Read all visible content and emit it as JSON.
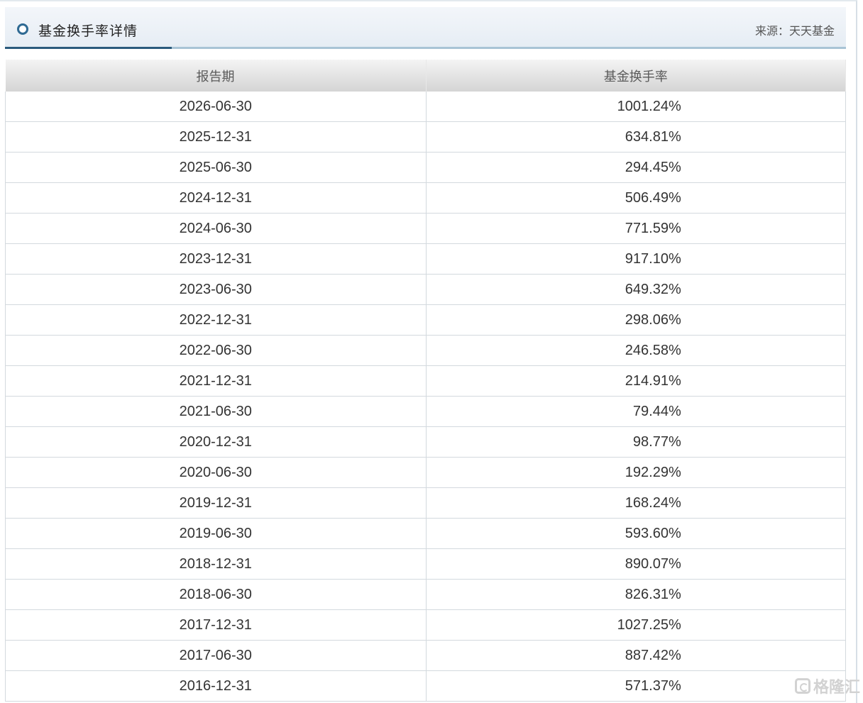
{
  "panel": {
    "title": "基金换手率详情",
    "source": "来源：天天基金"
  },
  "table": {
    "headers": [
      "报告期",
      "基金换手率"
    ],
    "rows": [
      {
        "period": "2026-06-30",
        "rate": "1001.24%"
      },
      {
        "period": "2025-12-31",
        "rate": "634.81%"
      },
      {
        "period": "2025-06-30",
        "rate": "294.45%"
      },
      {
        "period": "2024-12-31",
        "rate": "506.49%"
      },
      {
        "period": "2024-06-30",
        "rate": "771.59%"
      },
      {
        "period": "2023-12-31",
        "rate": "917.10%"
      },
      {
        "period": "2023-06-30",
        "rate": "649.32%"
      },
      {
        "period": "2022-12-31",
        "rate": "298.06%"
      },
      {
        "period": "2022-06-30",
        "rate": "246.58%"
      },
      {
        "period": "2021-12-31",
        "rate": "214.91%"
      },
      {
        "period": "2021-06-30",
        "rate": "79.44%"
      },
      {
        "period": "2020-12-31",
        "rate": "98.77%"
      },
      {
        "period": "2020-06-30",
        "rate": "192.29%"
      },
      {
        "period": "2019-12-31",
        "rate": "168.24%"
      },
      {
        "period": "2019-06-30",
        "rate": "593.60%"
      },
      {
        "period": "2018-12-31",
        "rate": "890.07%"
      },
      {
        "period": "2018-06-30",
        "rate": "826.31%"
      },
      {
        "period": "2017-12-31",
        "rate": "1027.25%"
      },
      {
        "period": "2017-06-30",
        "rate": "887.42%"
      },
      {
        "period": "2016-12-31",
        "rate": "571.37%"
      }
    ]
  },
  "watermark": {
    "text": "格隆汇"
  },
  "colors": {
    "accent": "#2a5a7c",
    "header_border": "#a9c4d5"
  }
}
